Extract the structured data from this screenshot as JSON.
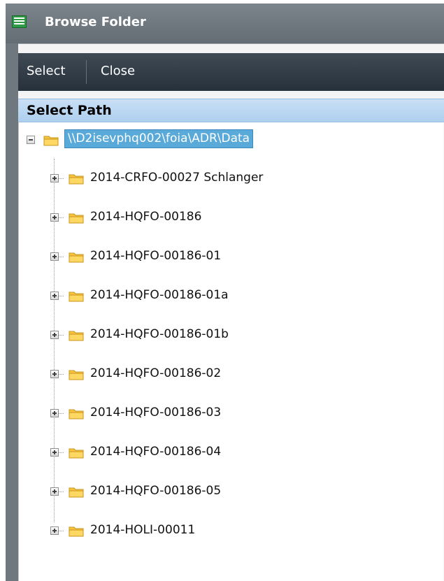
{
  "window": {
    "title": "Browse Folder"
  },
  "menu": {
    "select_label": "Select",
    "close_label": "Close"
  },
  "section": {
    "title": "Select Path"
  },
  "tree": {
    "root": "\\\\D2isevphq002\\foia\\ADR\\Data",
    "folders": [
      "2014-CRFO-00027 Schlanger",
      "2014-HQFO-00186",
      "2014-HQFO-00186-01",
      "2014-HQFO-00186-01a",
      "2014-HQFO-00186-01b",
      "2014-HQFO-00186-02",
      "2014-HQFO-00186-03",
      "2014-HQFO-00186-04",
      "2014-HQFO-00186-05",
      "2014-HOLI-00011"
    ]
  },
  "colors": {
    "selection": "#59a9d9",
    "header": "#b9d7f2",
    "menubar": "#2f3a44",
    "folder": "#f6c642"
  }
}
